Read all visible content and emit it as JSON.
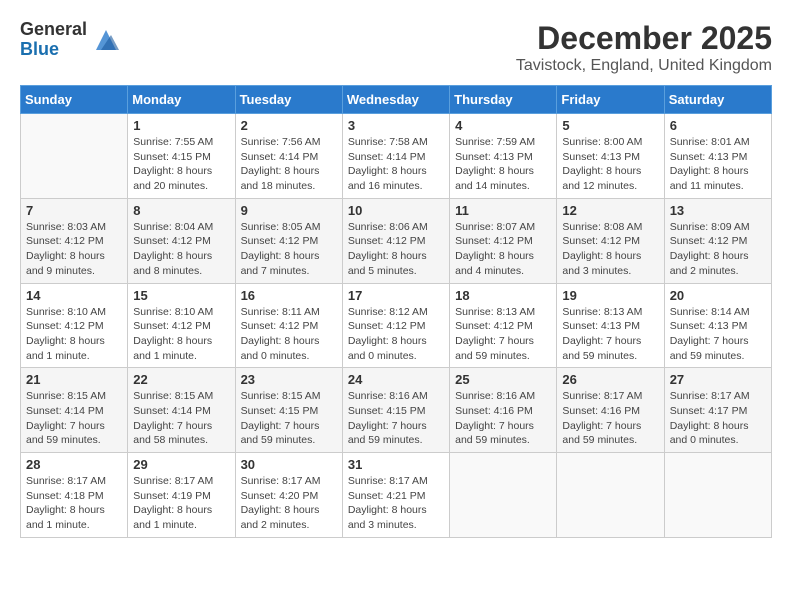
{
  "logo": {
    "general": "General",
    "blue": "Blue"
  },
  "title": "December 2025",
  "location": "Tavistock, England, United Kingdom",
  "days_of_week": [
    "Sunday",
    "Monday",
    "Tuesday",
    "Wednesday",
    "Thursday",
    "Friday",
    "Saturday"
  ],
  "weeks": [
    [
      {
        "day": "",
        "sunrise": "",
        "sunset": "",
        "daylight": ""
      },
      {
        "day": "1",
        "sunrise": "Sunrise: 7:55 AM",
        "sunset": "Sunset: 4:15 PM",
        "daylight": "Daylight: 8 hours and 20 minutes."
      },
      {
        "day": "2",
        "sunrise": "Sunrise: 7:56 AM",
        "sunset": "Sunset: 4:14 PM",
        "daylight": "Daylight: 8 hours and 18 minutes."
      },
      {
        "day": "3",
        "sunrise": "Sunrise: 7:58 AM",
        "sunset": "Sunset: 4:14 PM",
        "daylight": "Daylight: 8 hours and 16 minutes."
      },
      {
        "day": "4",
        "sunrise": "Sunrise: 7:59 AM",
        "sunset": "Sunset: 4:13 PM",
        "daylight": "Daylight: 8 hours and 14 minutes."
      },
      {
        "day": "5",
        "sunrise": "Sunrise: 8:00 AM",
        "sunset": "Sunset: 4:13 PM",
        "daylight": "Daylight: 8 hours and 12 minutes."
      },
      {
        "day": "6",
        "sunrise": "Sunrise: 8:01 AM",
        "sunset": "Sunset: 4:13 PM",
        "daylight": "Daylight: 8 hours and 11 minutes."
      }
    ],
    [
      {
        "day": "7",
        "sunrise": "Sunrise: 8:03 AM",
        "sunset": "Sunset: 4:12 PM",
        "daylight": "Daylight: 8 hours and 9 minutes."
      },
      {
        "day": "8",
        "sunrise": "Sunrise: 8:04 AM",
        "sunset": "Sunset: 4:12 PM",
        "daylight": "Daylight: 8 hours and 8 minutes."
      },
      {
        "day": "9",
        "sunrise": "Sunrise: 8:05 AM",
        "sunset": "Sunset: 4:12 PM",
        "daylight": "Daylight: 8 hours and 7 minutes."
      },
      {
        "day": "10",
        "sunrise": "Sunrise: 8:06 AM",
        "sunset": "Sunset: 4:12 PM",
        "daylight": "Daylight: 8 hours and 5 minutes."
      },
      {
        "day": "11",
        "sunrise": "Sunrise: 8:07 AM",
        "sunset": "Sunset: 4:12 PM",
        "daylight": "Daylight: 8 hours and 4 minutes."
      },
      {
        "day": "12",
        "sunrise": "Sunrise: 8:08 AM",
        "sunset": "Sunset: 4:12 PM",
        "daylight": "Daylight: 8 hours and 3 minutes."
      },
      {
        "day": "13",
        "sunrise": "Sunrise: 8:09 AM",
        "sunset": "Sunset: 4:12 PM",
        "daylight": "Daylight: 8 hours and 2 minutes."
      }
    ],
    [
      {
        "day": "14",
        "sunrise": "Sunrise: 8:10 AM",
        "sunset": "Sunset: 4:12 PM",
        "daylight": "Daylight: 8 hours and 1 minute."
      },
      {
        "day": "15",
        "sunrise": "Sunrise: 8:10 AM",
        "sunset": "Sunset: 4:12 PM",
        "daylight": "Daylight: 8 hours and 1 minute."
      },
      {
        "day": "16",
        "sunrise": "Sunrise: 8:11 AM",
        "sunset": "Sunset: 4:12 PM",
        "daylight": "Daylight: 8 hours and 0 minutes."
      },
      {
        "day": "17",
        "sunrise": "Sunrise: 8:12 AM",
        "sunset": "Sunset: 4:12 PM",
        "daylight": "Daylight: 8 hours and 0 minutes."
      },
      {
        "day": "18",
        "sunrise": "Sunrise: 8:13 AM",
        "sunset": "Sunset: 4:12 PM",
        "daylight": "Daylight: 7 hours and 59 minutes."
      },
      {
        "day": "19",
        "sunrise": "Sunrise: 8:13 AM",
        "sunset": "Sunset: 4:13 PM",
        "daylight": "Daylight: 7 hours and 59 minutes."
      },
      {
        "day": "20",
        "sunrise": "Sunrise: 8:14 AM",
        "sunset": "Sunset: 4:13 PM",
        "daylight": "Daylight: 7 hours and 59 minutes."
      }
    ],
    [
      {
        "day": "21",
        "sunrise": "Sunrise: 8:15 AM",
        "sunset": "Sunset: 4:14 PM",
        "daylight": "Daylight: 7 hours and 59 minutes."
      },
      {
        "day": "22",
        "sunrise": "Sunrise: 8:15 AM",
        "sunset": "Sunset: 4:14 PM",
        "daylight": "Daylight: 7 hours and 58 minutes."
      },
      {
        "day": "23",
        "sunrise": "Sunrise: 8:15 AM",
        "sunset": "Sunset: 4:15 PM",
        "daylight": "Daylight: 7 hours and 59 minutes."
      },
      {
        "day": "24",
        "sunrise": "Sunrise: 8:16 AM",
        "sunset": "Sunset: 4:15 PM",
        "daylight": "Daylight: 7 hours and 59 minutes."
      },
      {
        "day": "25",
        "sunrise": "Sunrise: 8:16 AM",
        "sunset": "Sunset: 4:16 PM",
        "daylight": "Daylight: 7 hours and 59 minutes."
      },
      {
        "day": "26",
        "sunrise": "Sunrise: 8:17 AM",
        "sunset": "Sunset: 4:16 PM",
        "daylight": "Daylight: 7 hours and 59 minutes."
      },
      {
        "day": "27",
        "sunrise": "Sunrise: 8:17 AM",
        "sunset": "Sunset: 4:17 PM",
        "daylight": "Daylight: 8 hours and 0 minutes."
      }
    ],
    [
      {
        "day": "28",
        "sunrise": "Sunrise: 8:17 AM",
        "sunset": "Sunset: 4:18 PM",
        "daylight": "Daylight: 8 hours and 1 minute."
      },
      {
        "day": "29",
        "sunrise": "Sunrise: 8:17 AM",
        "sunset": "Sunset: 4:19 PM",
        "daylight": "Daylight: 8 hours and 1 minute."
      },
      {
        "day": "30",
        "sunrise": "Sunrise: 8:17 AM",
        "sunset": "Sunset: 4:20 PM",
        "daylight": "Daylight: 8 hours and 2 minutes."
      },
      {
        "day": "31",
        "sunrise": "Sunrise: 8:17 AM",
        "sunset": "Sunset: 4:21 PM",
        "daylight": "Daylight: 8 hours and 3 minutes."
      },
      {
        "day": "",
        "sunrise": "",
        "sunset": "",
        "daylight": ""
      },
      {
        "day": "",
        "sunrise": "",
        "sunset": "",
        "daylight": ""
      },
      {
        "day": "",
        "sunrise": "",
        "sunset": "",
        "daylight": ""
      }
    ]
  ]
}
